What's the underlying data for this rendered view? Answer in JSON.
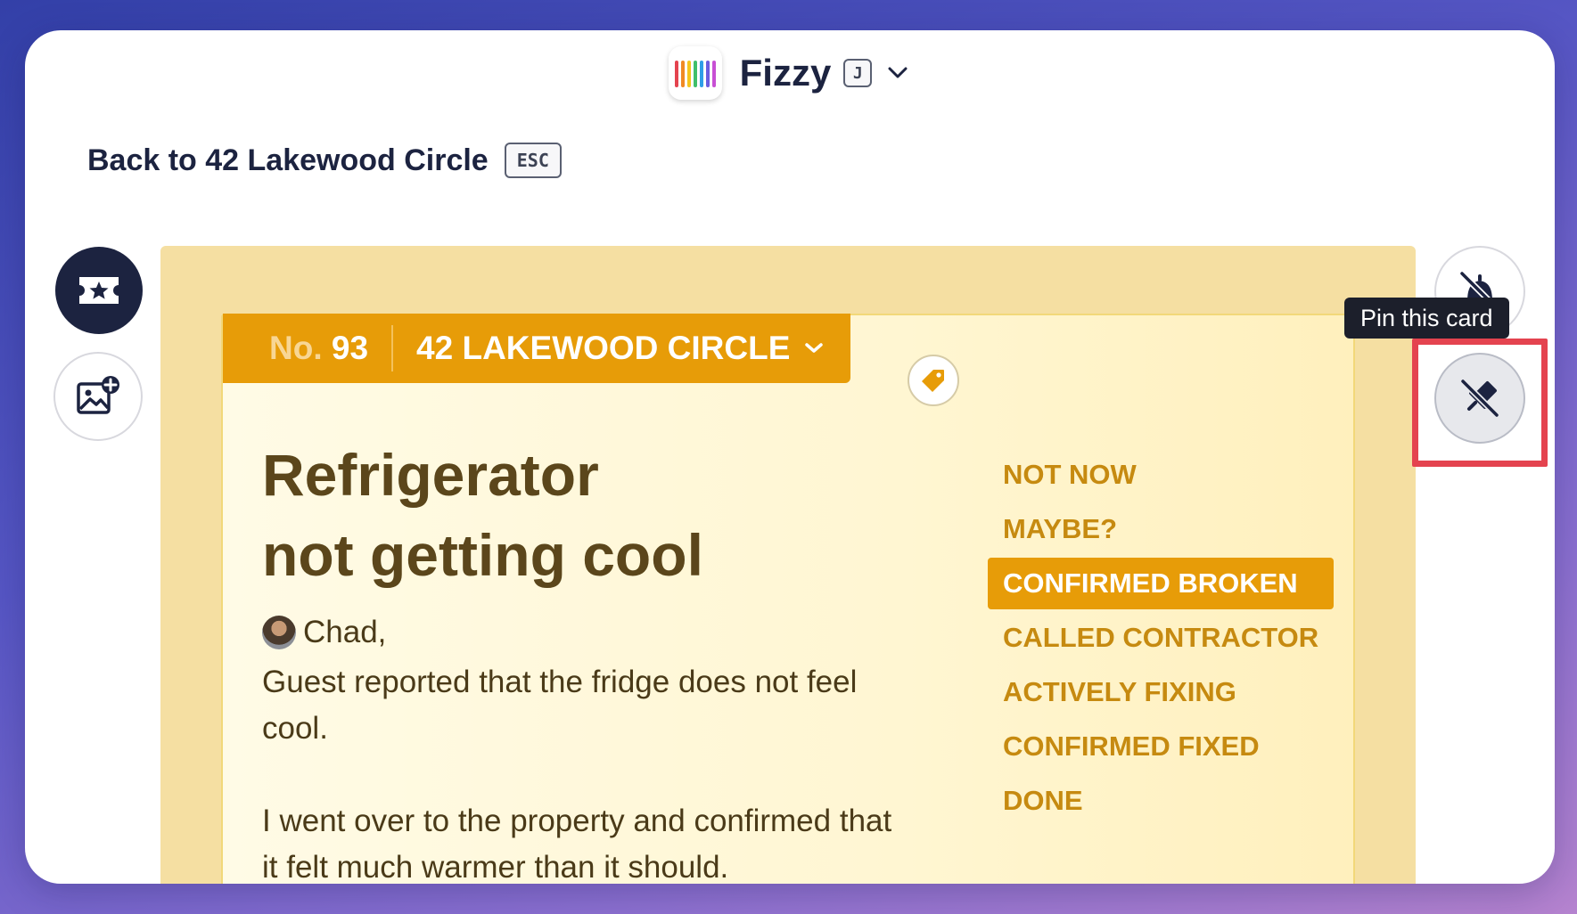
{
  "header": {
    "app_name": "Fizzy",
    "shortcut_key": "J",
    "logo_colors": [
      "#e4434f",
      "#f08a24",
      "#f5c51c",
      "#3fbf6a",
      "#2f9ee8",
      "#6b5de0",
      "#c84fd4"
    ]
  },
  "back": {
    "label": "Back to 42 Lakewood Circle",
    "shortcut": "ESC"
  },
  "card": {
    "number_label": "No.",
    "number": "93",
    "board": "42 LAKEWOOD CIRCLE",
    "title_line1": "Refrigerator",
    "title_line2": "not getting cool",
    "author": "Chad,",
    "body": [
      "Guest reported that the fridge does not feel cool.",
      "I went over to the property and confirmed that it felt much warmer than it should."
    ]
  },
  "stages": [
    {
      "label": "NOT NOW",
      "active": false
    },
    {
      "label": "MAYBE?",
      "active": false
    },
    {
      "label": "CONFIRMED BROKEN",
      "active": true
    },
    {
      "label": "CALLED CONTRACTOR",
      "active": false
    },
    {
      "label": "ACTIVELY FIXING",
      "active": false
    },
    {
      "label": "CONFIRMED FIXED",
      "active": false
    },
    {
      "label": "DONE",
      "active": false
    }
  ],
  "tooltip": {
    "text": "Pin this card"
  },
  "colors": {
    "accent": "#e79c08",
    "highlight": "#e4434f",
    "navy": "#1c2340"
  }
}
